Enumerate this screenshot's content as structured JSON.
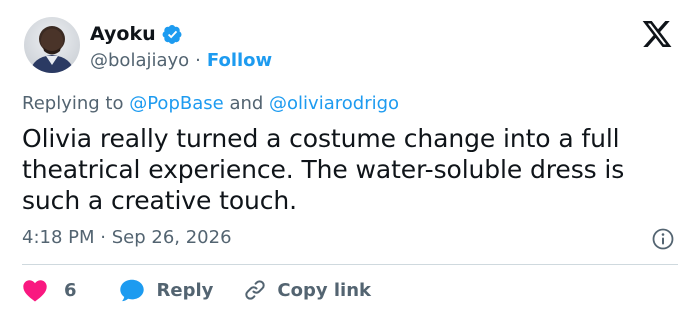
{
  "author": {
    "name": "Ayoku",
    "handle": "@bolajiayo",
    "separator": "·",
    "follow_label": "Follow"
  },
  "reply_context": {
    "prefix": "Replying to",
    "mention_1": "@PopBase",
    "conjunction": "and",
    "mention_2": "@oliviarodrigo"
  },
  "tweet": {
    "text": "Olivia really turned a costume change into a full theatrical experience. The water-soluble dress is such a creative touch.",
    "time": "4:18 PM",
    "separator": "·",
    "date": "Sep 26, 2026"
  },
  "actions": {
    "like_count": "6",
    "reply_label": "Reply",
    "copy_link_label": "Copy link"
  },
  "colors": {
    "accent": "#1d9bf0",
    "like": "#f91880",
    "text": "#0f1419",
    "secondary": "#536471",
    "divider": "#cfd9de"
  },
  "icons": [
    "avatar",
    "verified-badge-icon",
    "x-logo-icon",
    "info-icon",
    "heart-icon",
    "reply-bubble-icon",
    "link-icon"
  ]
}
